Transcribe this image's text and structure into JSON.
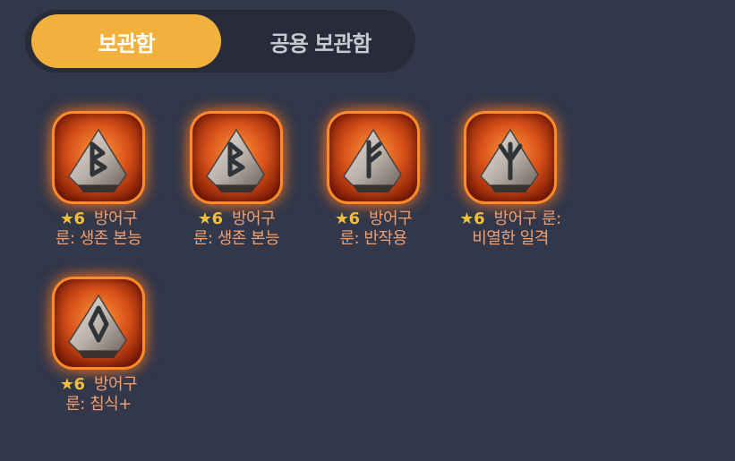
{
  "tabs": {
    "storage": "보관함",
    "shared_storage": "공용 보관함"
  },
  "items": [
    {
      "star": "★",
      "grade": "6",
      "line1": "방어구",
      "line2": "룬: 생존 본능",
      "rune_icon": "rune-berkana-icon"
    },
    {
      "star": "★",
      "grade": "6",
      "line1": "방어구",
      "line2": "룬: 생존 본능",
      "rune_icon": "rune-berkana-icon"
    },
    {
      "star": "★",
      "grade": "6",
      "line1": "방어구",
      "line2": "룬: 반작용",
      "rune_icon": "rune-fehu-icon"
    },
    {
      "star": "★",
      "grade": "6",
      "line1": "방어구 룬:",
      "line2": "비열한 일격",
      "rune_icon": "rune-algiz-icon"
    },
    {
      "star": "★",
      "grade": "6",
      "line1": "방어구",
      "line2": "룬: 침식+",
      "rune_icon": "rune-ingwaz-icon"
    }
  ],
  "colors": {
    "background": "#32374a",
    "tab_active": "#f2b13c",
    "label_text": "#f0a070",
    "star": "#f2c13c",
    "frame_border": "#ff8a2a"
  }
}
